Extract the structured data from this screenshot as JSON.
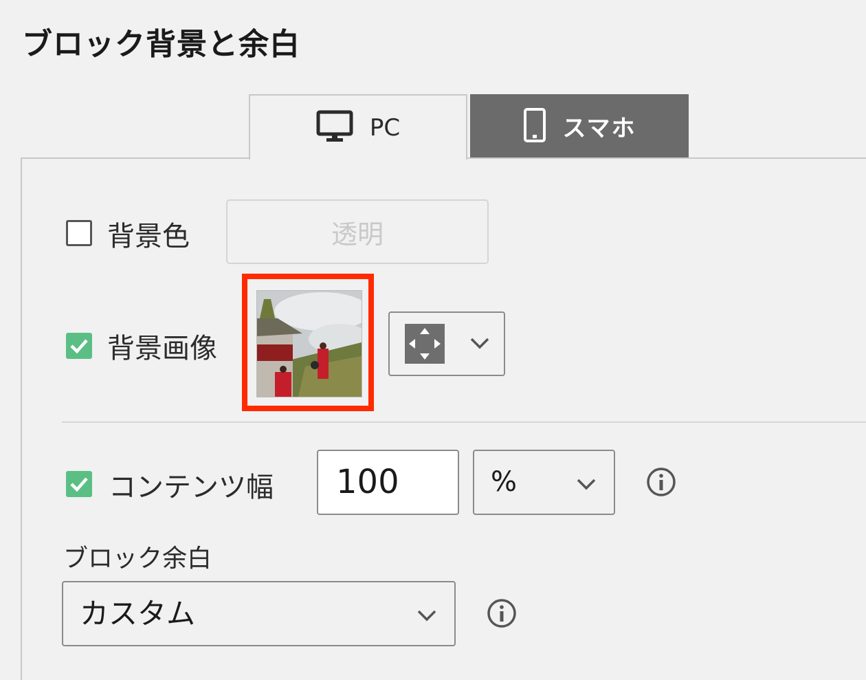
{
  "section_title": "ブロック背景と余白",
  "tabs": [
    {
      "label": "PC",
      "icon": "desktop-icon",
      "active": true
    },
    {
      "label": "スマホ",
      "icon": "smartphone-icon",
      "active": false
    }
  ],
  "background_color": {
    "label": "背景色",
    "checked": false,
    "value": "透明"
  },
  "background_image": {
    "label": "背景画像",
    "checked": true,
    "position_icon": "position-arrows-icon"
  },
  "content_width": {
    "label": "コンテンツ幅",
    "checked": true,
    "value": "100",
    "unit": "%"
  },
  "block_margin": {
    "label": "ブロック余白",
    "value": "カスタム"
  },
  "colors": {
    "accent_green": "#5bbf85",
    "highlight_red": "#ff2a00",
    "tab_inactive": "#6b6b6b"
  }
}
